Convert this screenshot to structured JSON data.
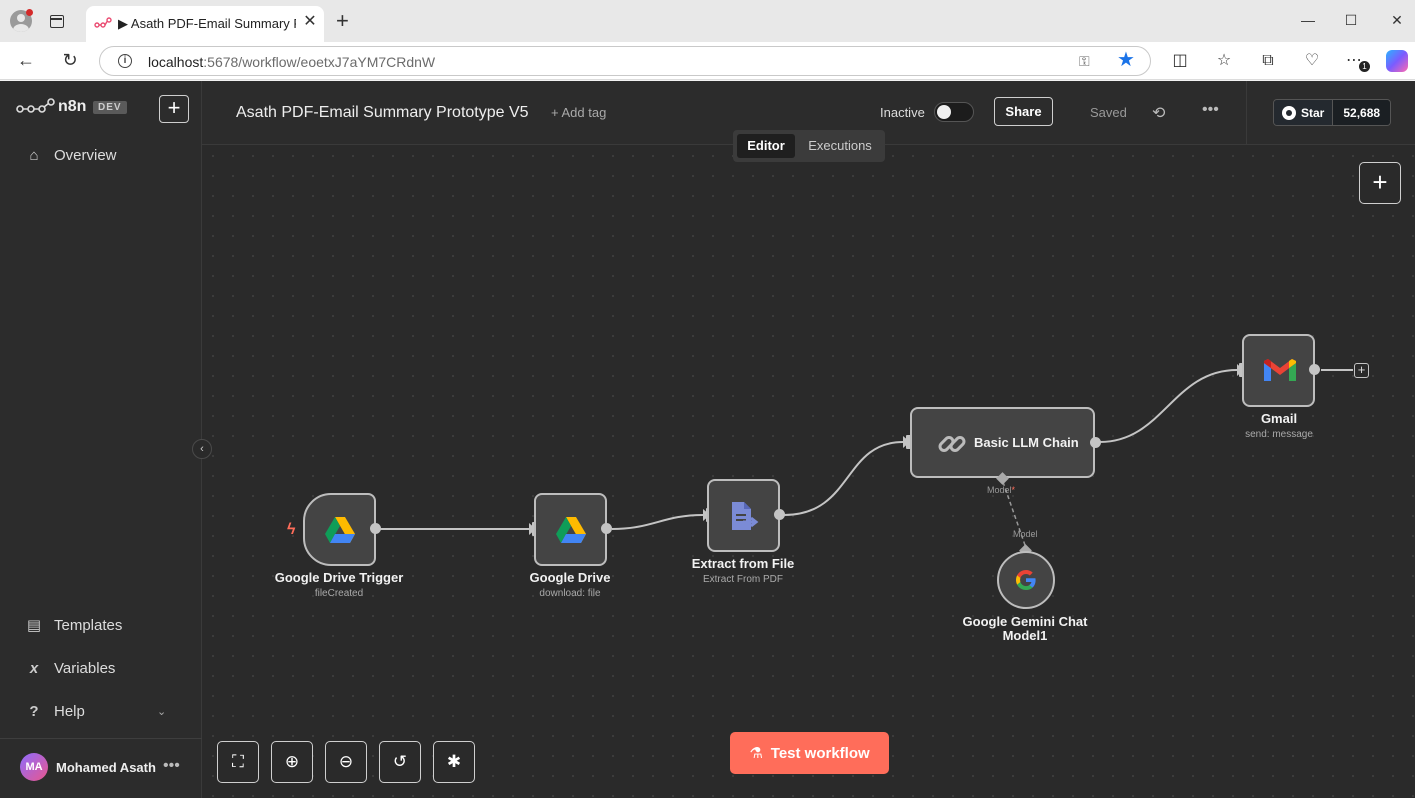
{
  "browser": {
    "tab_title": "▶ Asath PDF-Email Summary Pro",
    "tab_close": "✕",
    "new_tab": "+",
    "window_min": "—",
    "window_max": "☐",
    "window_close": "✕",
    "url_host": "localhost",
    "url_path": ":5678/workflow/eoetxJ7aYM7CRdnW",
    "extensions_badge": "1",
    "icons": [
      "profile-icon",
      "tab-actions-icon",
      "back-icon",
      "refresh-icon",
      "site-info-icon",
      "key-icon",
      "favorite-star-icon",
      "split-screen-icon",
      "favorites-icon",
      "collections-icon",
      "browser-essentials-icon",
      "more-icon",
      "copilot-icon"
    ]
  },
  "sidebar": {
    "logo_text": "n8n",
    "env_badge": "DEV",
    "add_label": "+",
    "items": [
      {
        "label": "Overview",
        "icon": "home-icon"
      },
      {
        "label": "Templates",
        "icon": "templates-icon"
      },
      {
        "label": "Variables",
        "icon": "variables-icon"
      },
      {
        "label": "Help",
        "icon": "help-icon"
      }
    ],
    "user": {
      "initials": "MA",
      "name": "Mohamed Asath",
      "more": "•••"
    },
    "collapse": "‹"
  },
  "header": {
    "workflow_title": "Asath PDF-Email Summary Prototype V5",
    "add_tag": "+ Add tag",
    "active_label": "Inactive",
    "active": false,
    "share_label": "Share",
    "saved_label": "Saved",
    "more": "•••",
    "github": {
      "star_label": "Star",
      "count": "52,688"
    }
  },
  "view_toggle": {
    "editor": "Editor",
    "executions": "Executions",
    "selected": "Editor"
  },
  "canvas": {
    "add_node": "+",
    "nodes": [
      {
        "id": "gdrive-trigger",
        "label": "Google Drive Trigger",
        "subtitle": "fileCreated",
        "icon": "google-drive-icon"
      },
      {
        "id": "gdrive",
        "label": "Google Drive",
        "subtitle": "download: file",
        "icon": "google-drive-icon"
      },
      {
        "id": "extract",
        "label": "Extract from File",
        "subtitle": "Extract From PDF",
        "icon": "file-export-icon"
      },
      {
        "id": "llm-chain",
        "label": "Basic LLM Chain",
        "subtitle": "",
        "icon": "link-icon"
      },
      {
        "id": "gmail",
        "label": "Gmail",
        "subtitle": "send: message",
        "icon": "gmail-icon"
      },
      {
        "id": "gemini",
        "label": "Google Gemini Chat Model1",
        "label_line1": "Google Gemini Chat",
        "label_line2": "Model1",
        "subtitle": "",
        "icon": "google-g-icon"
      }
    ],
    "ports": {
      "model_required": "Model",
      "required_mark": "*",
      "model_out": "Model"
    },
    "controls": [
      "fit-view-icon",
      "zoom-in-icon",
      "zoom-out-icon",
      "reset-zoom-icon",
      "debug-icon"
    ],
    "test_workflow": "Test workflow"
  },
  "colors": {
    "accent": "#ff6d5a",
    "canvas_bg": "#2a2a2a",
    "node_bg": "#444444",
    "node_border": "#bdbdbd",
    "edge": "#c4c4c4"
  }
}
